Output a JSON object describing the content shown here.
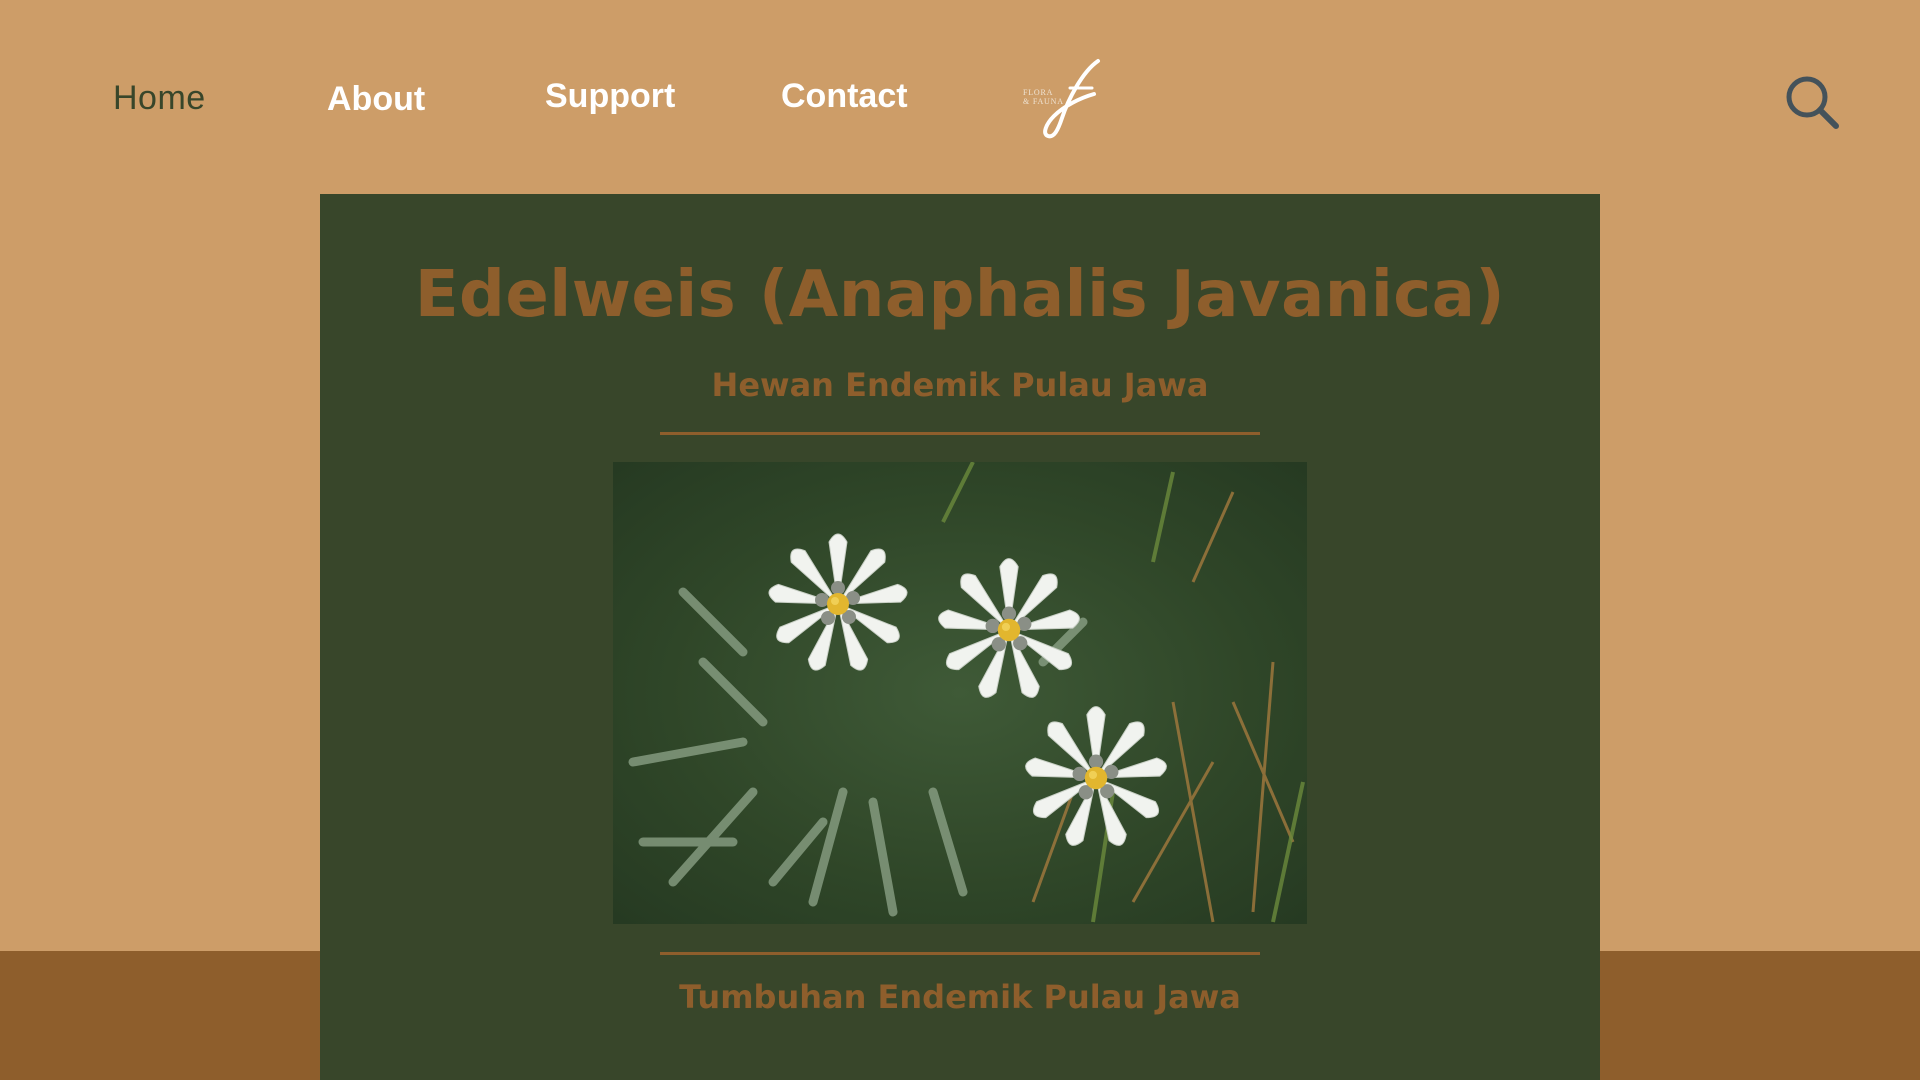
{
  "nav": {
    "home": "Home",
    "about": "About",
    "support": "Support",
    "contact": "Contact",
    "logo_line1": "FLORA",
    "logo_line2": "& FAUNA",
    "search_icon": "search-icon"
  },
  "hero": {
    "title": "Edelweis (Anaphalis Javanica)",
    "subtitle": "Hewan Endemik Pulau Jawa",
    "footer_caption": "Tumbuhan Endemik Pulau Jawa",
    "image_subject": "edelweiss-flowers-photo"
  },
  "colors": {
    "page_background": "#CD9D68",
    "bottom_band": "#8E5E2C",
    "card_background": "#38462A",
    "heading": "#8E5E2C",
    "nav_active": "#38462A",
    "nav_text": "#FFFFFF",
    "search_icon": "#44525A"
  }
}
